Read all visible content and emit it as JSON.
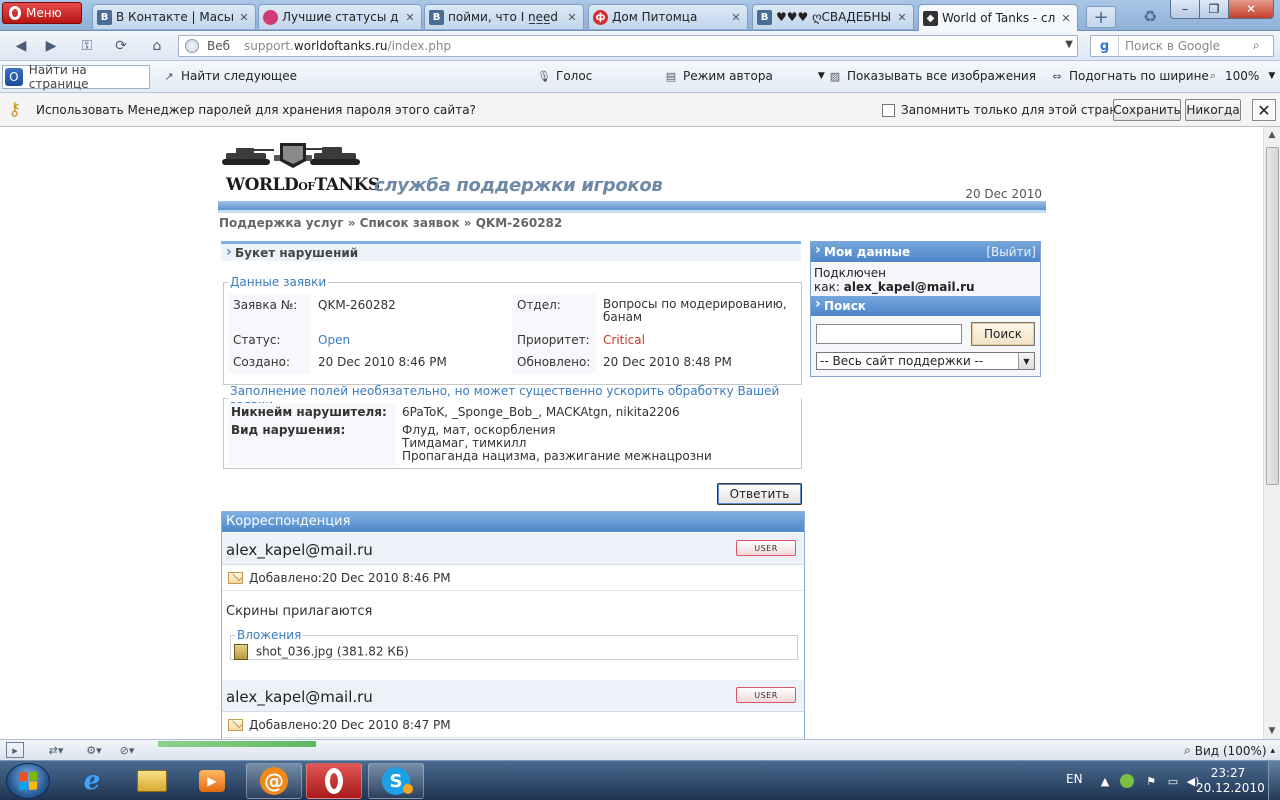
{
  "browser": {
    "menu_label": "Меню",
    "tabs": [
      {
        "title": "В Контакте | Маськ...",
        "icon": "vk-icon"
      },
      {
        "title": "Лучшие статусы дл...",
        "icon": "chat-bubble-icon"
      },
      {
        "title": "пойми, что I n̲e̲e̲d ...",
        "icon": "vk-icon"
      },
      {
        "title": "Дом Питомца",
        "icon": "pet-site-icon"
      },
      {
        "title": "♥♥♥ ღСВАДЕБНЫ...",
        "icon": "vk-icon"
      },
      {
        "title": "World of Tanks - сл...",
        "icon": "wot-icon"
      }
    ],
    "address": {
      "scope_label": "Веб",
      "url_prefix": "support.",
      "url_domain": "worldoftanks.ru",
      "url_path": "/index.php"
    },
    "search_placeholder": "Поиск в Google",
    "findbar": {
      "find_placeholder": "Найти на странице",
      "find_next": "Найти следующее",
      "voice": "Голос",
      "author_mode": "Режим автора",
      "show_images": "Показывать все изображения",
      "fit_width": "Подогнать по ширине",
      "zoom": "100%"
    },
    "password_bar": {
      "message": "Использовать Менеджер паролей для хранения пароля этого сайта?",
      "remember_only": "Запомнить только для этой страницы",
      "save": "Сохранить",
      "never": "Никогда"
    },
    "status_zoom": "Вид (100%)",
    "status_progress": 1.0
  },
  "page": {
    "site_title": "служба поддержки игроков",
    "logo_text": {
      "world": "WORLD",
      "of": "OF",
      "tanks": "TANKS"
    },
    "header_date": "20 Dec 2010",
    "breadcrumb": "Поддержка услуг » Список заявок » QKM-260282",
    "ticket_title": "Букет нарушений",
    "ticket_data": {
      "legend": "Данные заявки",
      "id_label": "Заявка №:",
      "id_value": "QKM-260282",
      "dept_label": "Отдел:",
      "dept_value": "Вопросы по модерированию, банам",
      "status_label": "Статус:",
      "status_value": "Open",
      "priority_label": "Приоритет:",
      "priority_value": "Critical",
      "created_label": "Создано:",
      "created_value": "20 Dec 2010 8:46 PM",
      "updated_label": "Обновлено:",
      "updated_value": "20 Dec 2010 8:48 PM"
    },
    "optional_fields": {
      "legend": "Заполнение полей необязательно, но может существенно ускорить обработку Вашей заявки",
      "nick_label": "Никнейм нарушителя:",
      "nick_value": "6PaToK, _Sponge_Bob_, MACKAtgn, nikita2206",
      "type_label": "Вид нарушения:",
      "type_lines": [
        "Флуд, мат, оскорбления",
        "Тимдамаг, тимкилл",
        "Пропаганда нацизма, разжигание межнацрозни"
      ]
    },
    "reply_label": "Ответить",
    "correspondence": {
      "title": "Корреспонденция",
      "messages": [
        {
          "author": "alex_kapel@mail.ru",
          "badge": "USER",
          "added": "Добавлено:20 Dec 2010 8:46 PM",
          "body": "Скрины прилагаются",
          "attachments_legend": "Вложения",
          "attachment_name": "shot_036.jpg",
          "attachment_size": "(381.82 КБ)"
        },
        {
          "author": "alex_kapel@mail.ru",
          "badge": "USER",
          "added": "Добавлено:20 Dec 2010 8:47 PM"
        }
      ]
    },
    "sidebar": {
      "my_data_title": "Мои данные",
      "logout": "[Выйти]",
      "connected_line1": "Подключен",
      "connected_prefix": "как:",
      "connected_email": "alex_kapel@mail.ru",
      "search_title": "Поиск",
      "search_button": "Поиск",
      "scope_select": "-- Весь сайт поддержки --"
    }
  },
  "taskbar": {
    "lang": "EN",
    "time": "23:27",
    "date": "20.12.2010",
    "apps": [
      "internet-explorer",
      "explorer",
      "media-player",
      "mail-agent",
      "opera",
      "skype"
    ]
  }
}
